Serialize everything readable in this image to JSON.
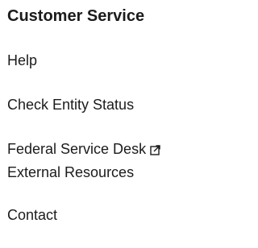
{
  "customer_service": {
    "heading": "Customer Service",
    "links": [
      {
        "label": "Help",
        "external": false
      },
      {
        "label": "Check Entity Status",
        "external": false
      },
      {
        "label": "Federal Service Desk",
        "external": true,
        "icon": "external-link-icon"
      },
      {
        "label": "External Resources",
        "external": false
      },
      {
        "label": "Contact",
        "external": false
      }
    ]
  }
}
